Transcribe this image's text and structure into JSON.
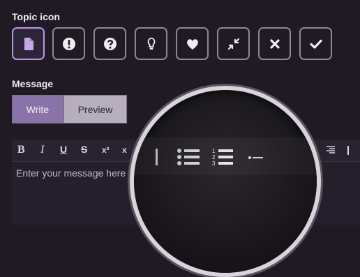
{
  "topic_icon": {
    "label": "Topic icon",
    "icons": [
      {
        "name": "document-icon",
        "selected": true
      },
      {
        "name": "exclamation-icon",
        "selected": false
      },
      {
        "name": "question-icon",
        "selected": false
      },
      {
        "name": "lightbulb-icon",
        "selected": false
      },
      {
        "name": "heart-icon",
        "selected": false
      },
      {
        "name": "compress-icon",
        "selected": false
      },
      {
        "name": "close-icon",
        "selected": false
      },
      {
        "name": "check-icon",
        "selected": false
      }
    ]
  },
  "message": {
    "label": "Message",
    "tabs": {
      "write": "Write",
      "preview": "Preview"
    },
    "placeholder": "Enter your message here"
  },
  "toolbar": {
    "bold": "B",
    "italic": "I",
    "underline": "U",
    "strike": "S",
    "superscript": "x²",
    "subscript": "x"
  },
  "colors": {
    "accent": "#b596dd",
    "background": "#1f1a24"
  }
}
